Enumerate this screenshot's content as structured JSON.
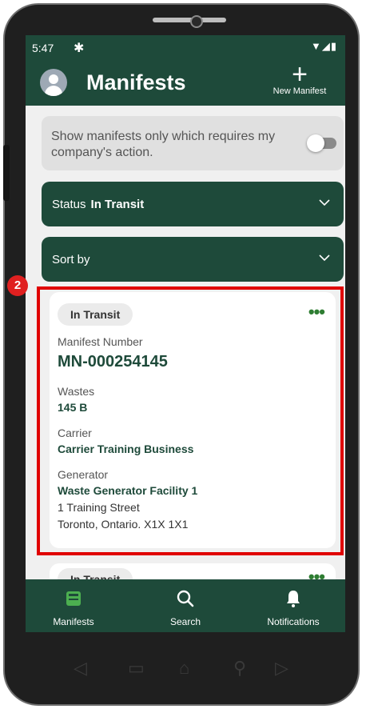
{
  "status_bar": {
    "time": "5:47"
  },
  "header": {
    "title": "Manifests",
    "new_button_label": "New Manifest"
  },
  "filter": {
    "text": "Show manifests only which requires my company's action.",
    "toggle_on": false
  },
  "status_dropdown": {
    "label": "Status",
    "value": "In Transit"
  },
  "sort_dropdown": {
    "label": "Sort by"
  },
  "annotation": {
    "number": "2"
  },
  "card": {
    "status": "In Transit",
    "manifest_label": "Manifest Number",
    "manifest_number": "MN-000254145",
    "wastes_label": "Wastes",
    "wastes_value": "145 B",
    "carrier_label": "Carrier",
    "carrier_value": "Carrier Training Business",
    "generator_label": "Generator",
    "generator_name": "Waste Generator Facility 1",
    "generator_address_line1": "1 Training Street",
    "generator_address_line2": "Toronto, Ontario. X1X 1X1"
  },
  "card2": {
    "status": "In Transit"
  },
  "bottom_nav": [
    {
      "label": "Manifests",
      "icon": "inbox-icon",
      "active": true
    },
    {
      "label": "Search",
      "icon": "search-icon",
      "active": false
    },
    {
      "label": "Notifications",
      "icon": "bell-icon",
      "active": false
    }
  ],
  "colors": {
    "primary": "#1e4a3a",
    "accent_green": "#2e7d32",
    "active_nav": "#4caf50",
    "annotation_red": "#e00000"
  }
}
